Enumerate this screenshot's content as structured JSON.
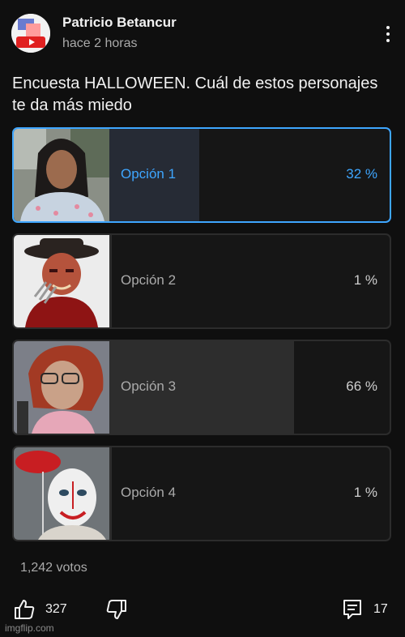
{
  "post": {
    "author": "Patricio Betancur",
    "time": "hace 2 horas",
    "title": "Encuesta HALLOWEEN. Cuál de estos personajes te da más miedo",
    "avatar_text": "YouTube"
  },
  "poll": {
    "options": [
      {
        "label": "Opción 1",
        "percent": "32 %",
        "fill": 0.32,
        "selected": true,
        "image": "woman-portrait-photo"
      },
      {
        "label": "Opción 2",
        "percent": "1 %",
        "fill": 0.01,
        "selected": false,
        "image": "freddy-krueger-photo"
      },
      {
        "label": "Opción 3",
        "percent": "66 %",
        "fill": 0.66,
        "selected": false,
        "image": "older-woman-photo"
      },
      {
        "label": "Opción 4",
        "percent": "1 %",
        "fill": 0.01,
        "selected": false,
        "image": "pennywise-clown-photo"
      }
    ],
    "votes": "1,242 votos"
  },
  "actions": {
    "likes": "327",
    "comments": "17"
  },
  "watermark": "imgflip.com",
  "colors": {
    "background": "#0f0f0f",
    "accent": "#3ea6ff",
    "fill": "#2d2d2d"
  }
}
